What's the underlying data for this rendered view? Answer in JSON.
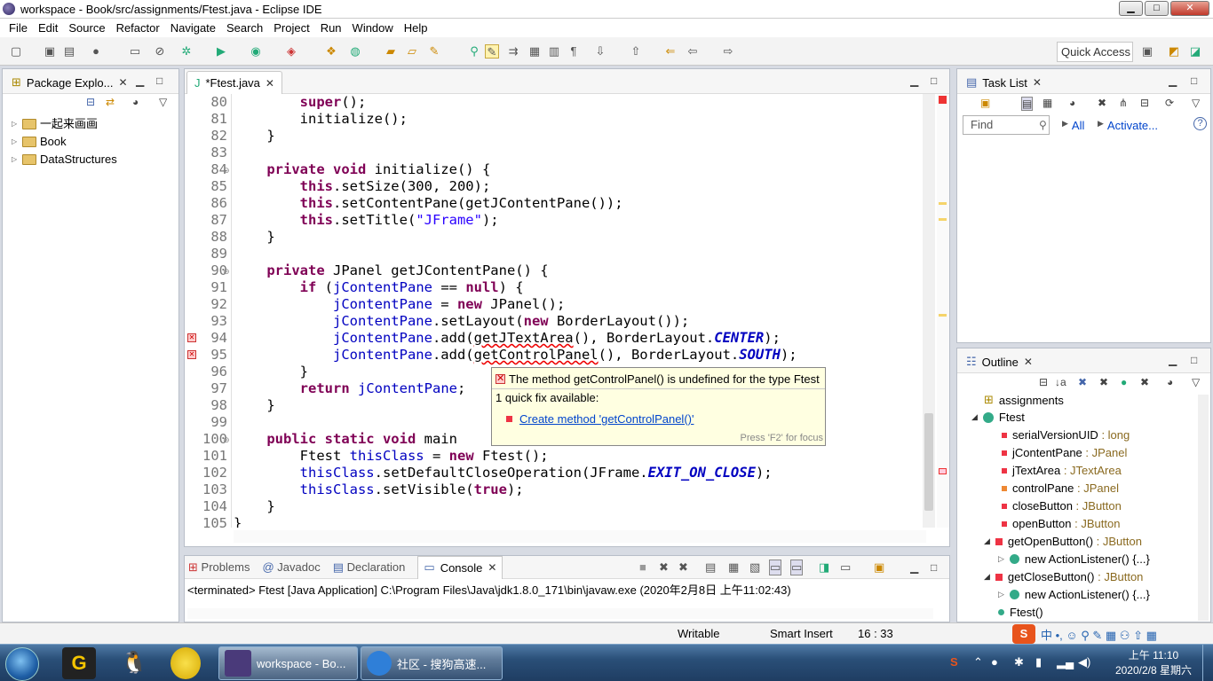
{
  "window": {
    "title": "workspace - Book/src/assignments/Ftest.java - Eclipse IDE",
    "min": "▁",
    "max": "□",
    "close": "✕"
  },
  "menu": [
    "File",
    "Edit",
    "Source",
    "Refactor",
    "Navigate",
    "Search",
    "Project",
    "Run",
    "Window",
    "Help"
  ],
  "toolbar": {
    "quick_access": "Quick Access"
  },
  "package_explorer": {
    "title": "Package Explo...",
    "projects": [
      "一起来画画",
      "Book",
      "DataStructures"
    ]
  },
  "editor": {
    "tab": "*Ftest.java",
    "line_numbers": [
      "80",
      "81",
      "82",
      "83",
      "84",
      "85",
      "86",
      "87",
      "88",
      "89",
      "90",
      "91",
      "92",
      "93",
      "94",
      "95",
      "96",
      "97",
      "98",
      "99",
      "100",
      "101",
      "102",
      "103",
      "104",
      "105"
    ]
  },
  "tooltip": {
    "message": "The method getControlPanel() is undefined for the type Ftest",
    "count": "1 quick fix available:",
    "fix": "Create method 'getControlPanel()'",
    "hint": "Press 'F2' for focus"
  },
  "console": {
    "tabs": [
      "Problems",
      "Javadoc",
      "Declaration",
      "Console"
    ],
    "text": "<terminated> Ftest [Java Application] C:\\Program Files\\Java\\jdk1.8.0_171\\bin\\javaw.exe (2020年2月8日 上午11:02:43)"
  },
  "task_list": {
    "title": "Task List",
    "find_placeholder": "Find",
    "all": "All",
    "activate": "Activate..."
  },
  "outline": {
    "title": "Outline",
    "package": "assignments",
    "class": "Ftest",
    "members": [
      {
        "name": "serialVersionUID",
        "type": " : long"
      },
      {
        "name": "jContentPane",
        "type": " : JPanel"
      },
      {
        "name": "jTextArea",
        "type": " : JTextArea"
      },
      {
        "name": "controlPane",
        "type": " : JPanel"
      },
      {
        "name": "closeButton",
        "type": " : JButton"
      },
      {
        "name": "openButton",
        "type": " : JButton"
      },
      {
        "name": "getOpenButton()",
        "type": " : JButton"
      },
      {
        "name": "new ActionListener() {...}",
        "type": ""
      },
      {
        "name": "getCloseButton()",
        "type": " : JButton"
      },
      {
        "name": "new ActionListener() {...}",
        "type": ""
      },
      {
        "name": "Ftest()",
        "type": ""
      }
    ]
  },
  "status": {
    "writable": "Writable",
    "insert": "Smart Insert",
    "pos": "16 : 33"
  },
  "taskbar": {
    "tasks": [
      "workspace - Bo...",
      "社区 - 搜狗高速..."
    ],
    "time": "上午 11:10",
    "date": "2020/2/8 星期六"
  }
}
